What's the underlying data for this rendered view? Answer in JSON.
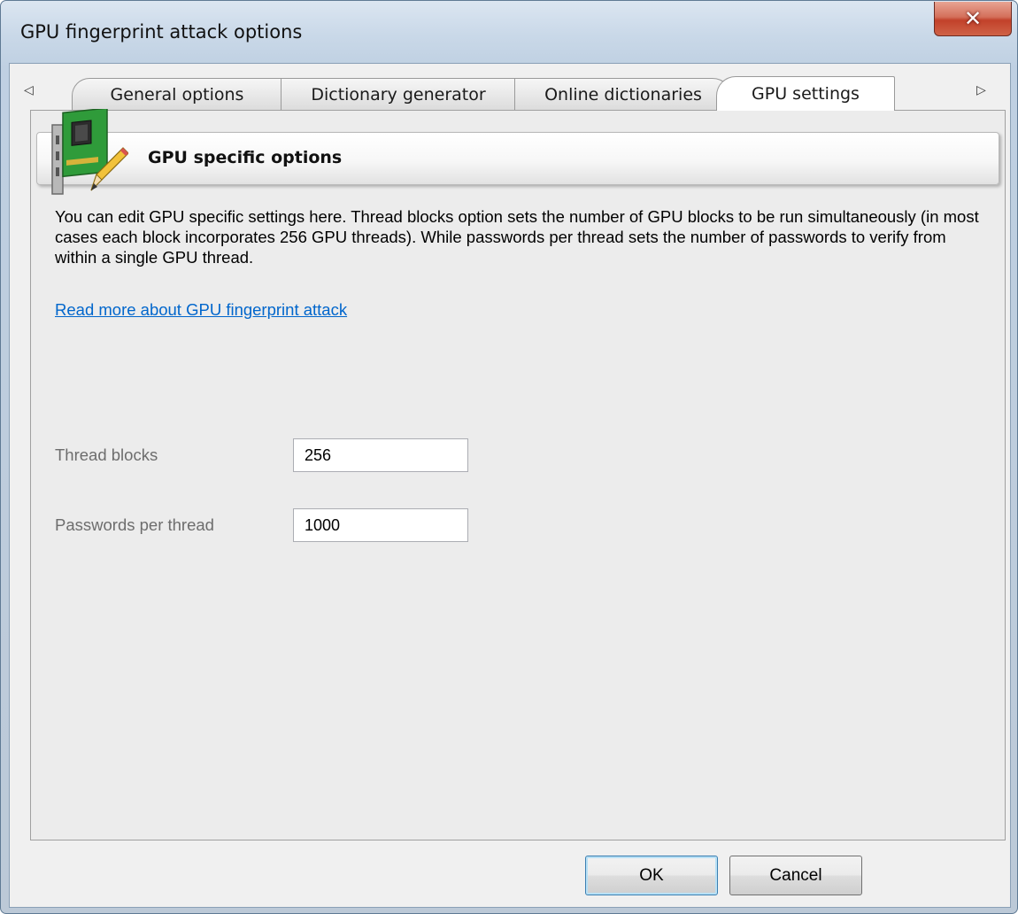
{
  "window": {
    "title": "GPU fingerprint attack options",
    "close_glyph": "✕"
  },
  "tabs": {
    "prev_arrow": "◁",
    "next_arrow": "▷",
    "items": [
      {
        "label": "General options"
      },
      {
        "label": "Dictionary generator"
      },
      {
        "label": "Online dictionaries"
      },
      {
        "label": "GPU settings"
      }
    ],
    "active": "GPU settings"
  },
  "section": {
    "title": "GPU specific options",
    "icon": "gpu-card-edit-icon"
  },
  "description": "You can edit GPU specific settings here. Thread blocks option sets the number of GPU blocks to be run simultaneously (in most cases each block incorporates 256 GPU threads). While passwords per thread sets the number of passwords to verify from within a single GPU thread.",
  "link": "Read more about GPU fingerprint attack",
  "fields": {
    "thread_blocks": {
      "label": "Thread blocks",
      "value": "256"
    },
    "passwords_per_thread": {
      "label": "Passwords per thread",
      "value": "1000"
    }
  },
  "buttons": {
    "ok": "OK",
    "cancel": "Cancel"
  },
  "colors": {
    "link": "#0066cc",
    "close_button": "#c2412a",
    "title_bar": "#c9d8e8"
  }
}
